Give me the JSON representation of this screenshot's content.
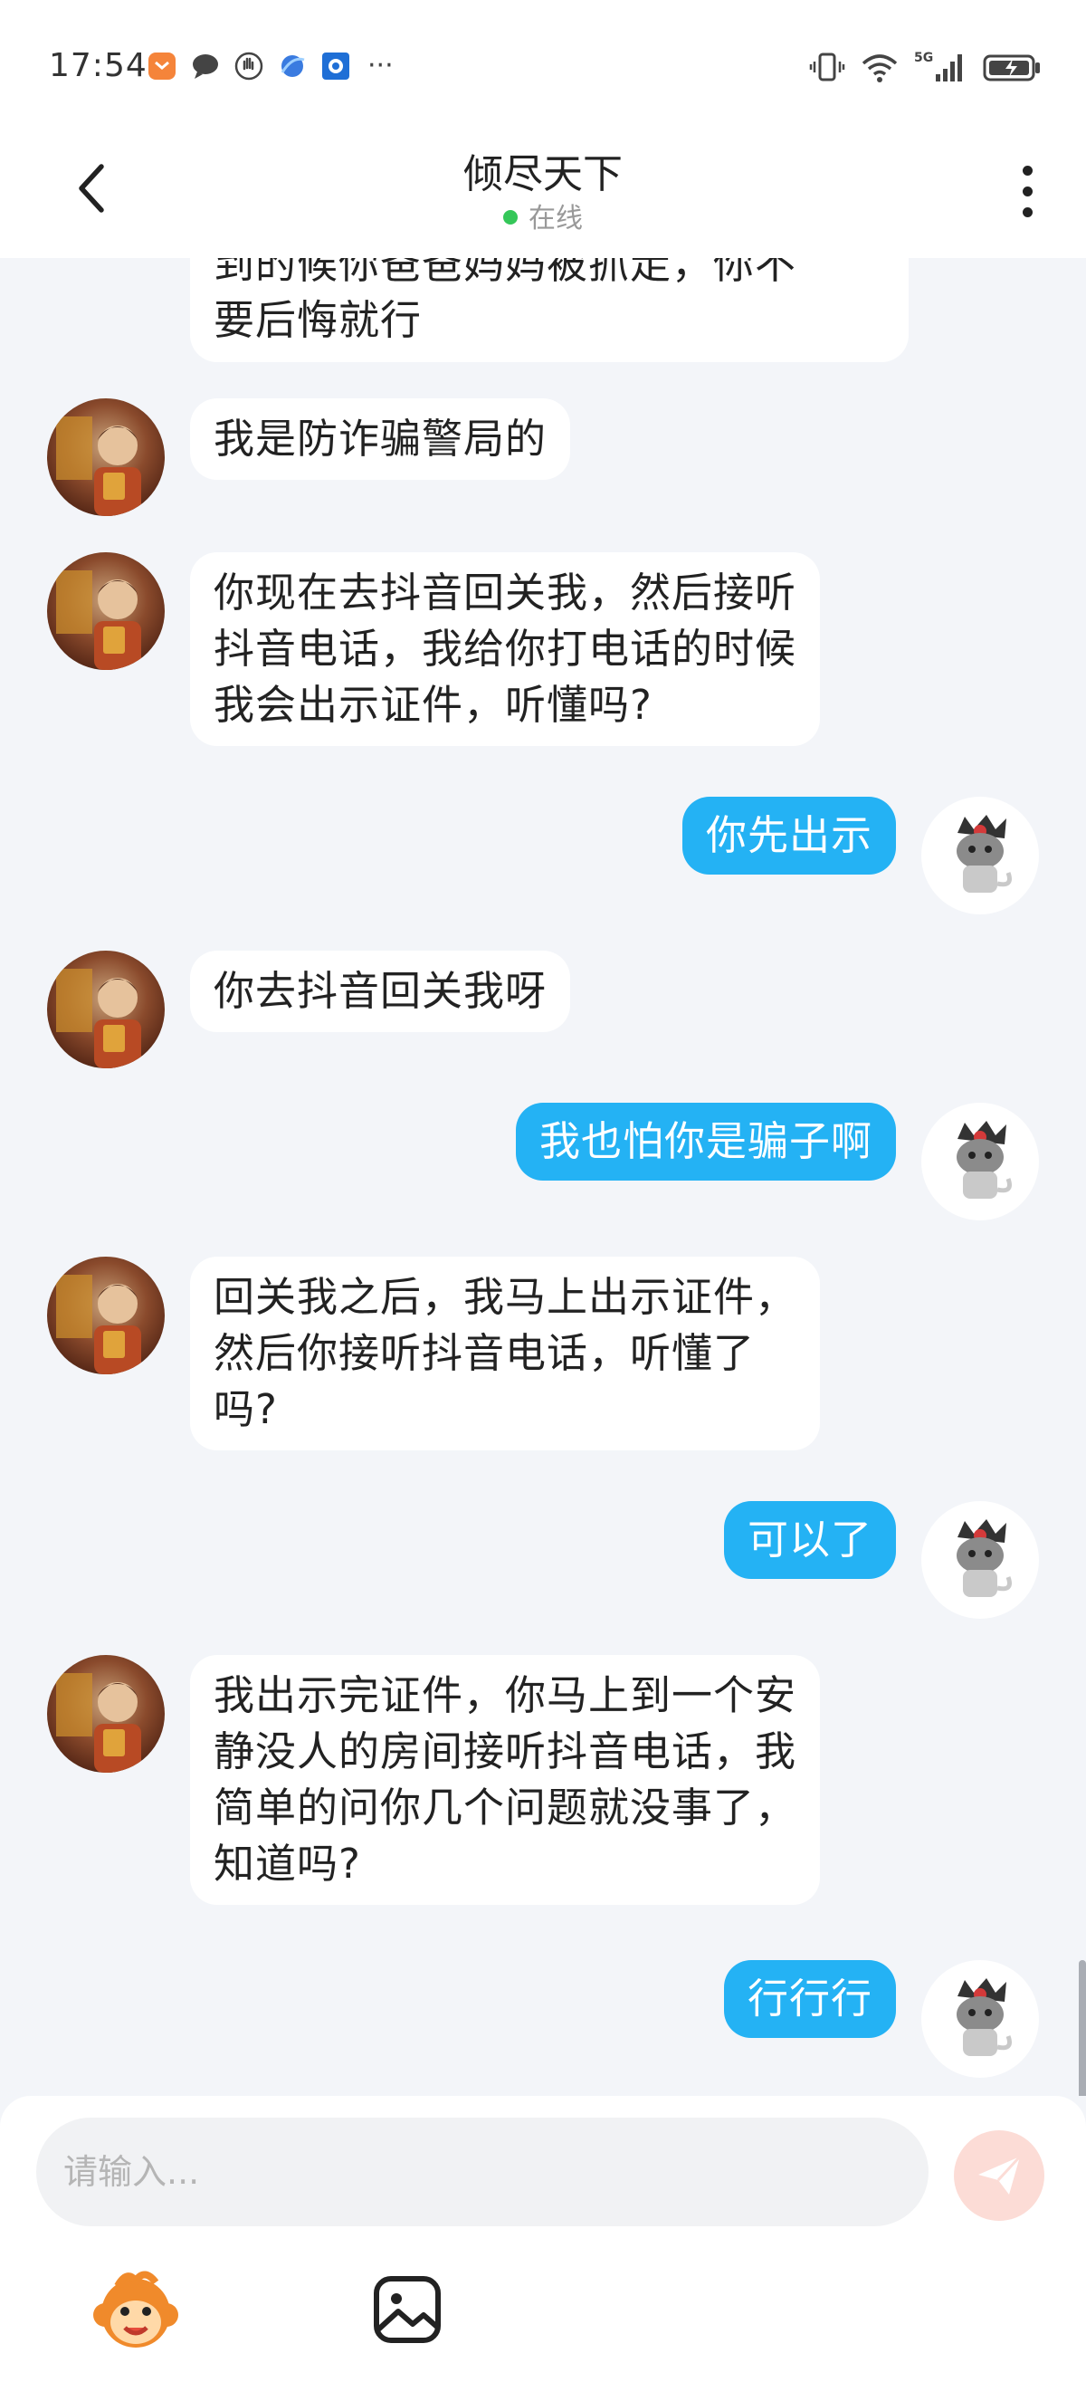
{
  "status_bar": {
    "time": "17:54",
    "more": "···",
    "network": "5G"
  },
  "header": {
    "title": "倾尽天下",
    "status": "在线"
  },
  "messages": [
    {
      "side": "in",
      "lines": [
        "到的候你爸爸妈妈被抓走，你不",
        "要后悔就行"
      ]
    },
    {
      "side": "in",
      "lines": [
        "我是防诈骗警局的"
      ]
    },
    {
      "side": "in",
      "lines": [
        "你现在去抖音回关我，然后接听",
        "抖音电话，我给你打电话的时候",
        "我会出示证件，听懂吗?"
      ]
    },
    {
      "side": "out",
      "lines": [
        "你先出示"
      ]
    },
    {
      "side": "in",
      "lines": [
        "你去抖音回关我呀"
      ]
    },
    {
      "side": "out",
      "lines": [
        "我也怕你是骗子啊"
      ]
    },
    {
      "side": "in",
      "lines": [
        "回关我之后，我马上出示证件，",
        "然后你接听抖音电话，听懂了",
        "吗?"
      ]
    },
    {
      "side": "out",
      "lines": [
        "可以了"
      ]
    },
    {
      "side": "in",
      "lines": [
        "我出示完证件，你马上到一个安",
        "静没人的房间接听抖音电话，我",
        "简单的问你几个问题就没事了，",
        "知道吗?"
      ]
    },
    {
      "side": "out",
      "lines": [
        "行行行"
      ]
    }
  ],
  "input": {
    "placeholder": "请输入..."
  },
  "colors": {
    "outgoing_bubble": "#24b2f4",
    "incoming_bubble": "#ffffff",
    "chat_background": "#f3f5f9",
    "online_dot": "#35c759",
    "send_button": "#fcdcd6"
  },
  "icons": {
    "back": "chevron-left-icon",
    "more": "more-vertical-icon",
    "send": "paper-plane-icon",
    "emoji": "monkey-emoji-icon",
    "image": "image-icon"
  }
}
